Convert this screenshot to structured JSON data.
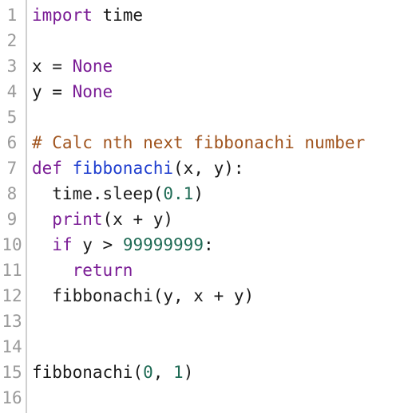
{
  "editor": {
    "lines": [
      {
        "number": "1",
        "tokens": [
          {
            "t": "import",
            "k": "kw"
          },
          {
            "t": " time",
            "k": ""
          }
        ]
      },
      {
        "number": "2",
        "tokens": []
      },
      {
        "number": "3",
        "tokens": [
          {
            "t": "x = ",
            "k": ""
          },
          {
            "t": "None",
            "k": "kw"
          }
        ]
      },
      {
        "number": "4",
        "tokens": [
          {
            "t": "y = ",
            "k": ""
          },
          {
            "t": "None",
            "k": "kw"
          }
        ]
      },
      {
        "number": "5",
        "tokens": []
      },
      {
        "number": "6",
        "tokens": [
          {
            "t": "# Calc nth next fibbonachi number",
            "k": "cm"
          }
        ]
      },
      {
        "number": "7",
        "tokens": [
          {
            "t": "def",
            "k": "kw"
          },
          {
            "t": " ",
            "k": ""
          },
          {
            "t": "fibbonachi",
            "k": "fn"
          },
          {
            "t": "(x, y):",
            "k": ""
          }
        ]
      },
      {
        "number": "8",
        "tokens": [
          {
            "t": "  time.sleep(",
            "k": ""
          },
          {
            "t": "0.1",
            "k": "num"
          },
          {
            "t": ")",
            "k": ""
          }
        ]
      },
      {
        "number": "9",
        "tokens": [
          {
            "t": "  ",
            "k": ""
          },
          {
            "t": "print",
            "k": "kw"
          },
          {
            "t": "(x + y)",
            "k": ""
          }
        ]
      },
      {
        "number": "10",
        "tokens": [
          {
            "t": "  ",
            "k": ""
          },
          {
            "t": "if",
            "k": "kw"
          },
          {
            "t": " y > ",
            "k": ""
          },
          {
            "t": "99999999",
            "k": "num"
          },
          {
            "t": ":",
            "k": ""
          }
        ]
      },
      {
        "number": "11",
        "tokens": [
          {
            "t": "    ",
            "k": ""
          },
          {
            "t": "return",
            "k": "kw"
          }
        ]
      },
      {
        "number": "12",
        "tokens": [
          {
            "t": "  fibbonachi(y, x + y)",
            "k": ""
          }
        ]
      },
      {
        "number": "13",
        "tokens": []
      },
      {
        "number": "14",
        "tokens": []
      },
      {
        "number": "15",
        "tokens": [
          {
            "t": "fibbonachi(",
            "k": ""
          },
          {
            "t": "0",
            "k": "num"
          },
          {
            "t": ", ",
            "k": ""
          },
          {
            "t": "1",
            "k": "num"
          },
          {
            "t": ")",
            "k": ""
          }
        ]
      },
      {
        "number": "16",
        "tokens": []
      }
    ]
  },
  "colors": {
    "keyword": "#7a1c95",
    "function": "#1f3ecf",
    "comment": "#a0541e",
    "number": "#1f6b55",
    "text": "#1a1a1a",
    "line_number": "#9a9a9a"
  }
}
